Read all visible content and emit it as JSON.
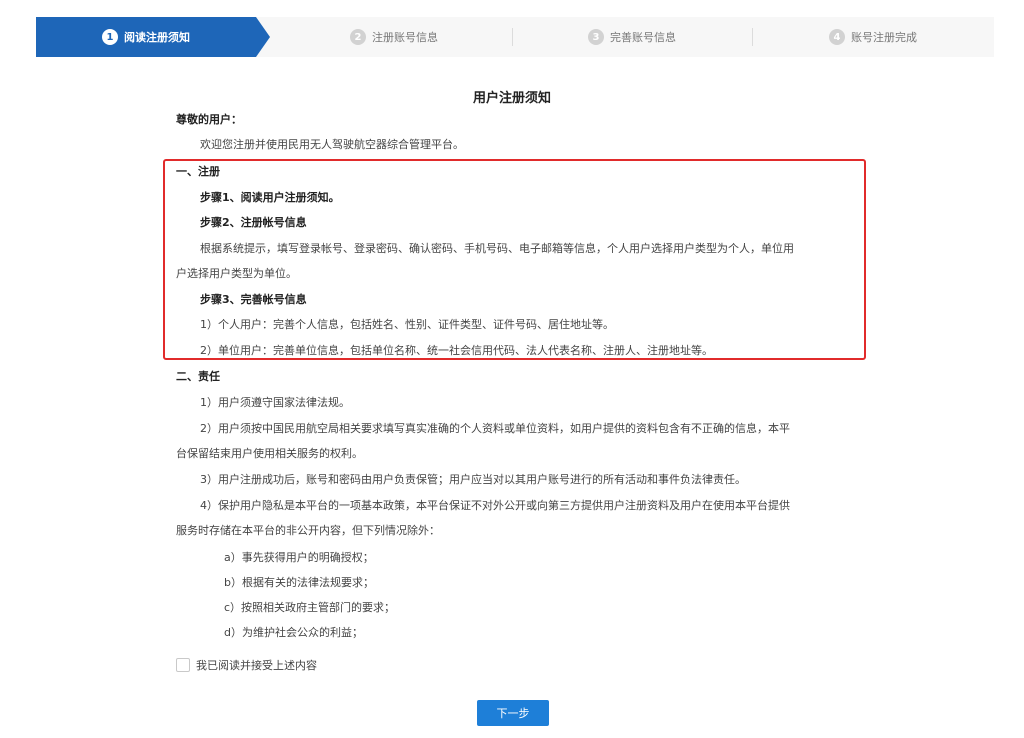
{
  "steps": [
    {
      "num": "1",
      "label": "阅读注册须知",
      "active": true
    },
    {
      "num": "2",
      "label": "注册账号信息",
      "active": false
    },
    {
      "num": "3",
      "label": "完善账号信息",
      "active": false
    },
    {
      "num": "4",
      "label": "账号注册完成",
      "active": false
    }
  ],
  "notice": {
    "title": "用户注册须知",
    "greeting": "尊敬的用户：",
    "welcome": "欢迎您注册并使用民用无人驾驶航空器综合管理平台。",
    "sec1_title": "一、注册",
    "step1": "步骤1、阅读用户注册须知。",
    "step2": "步骤2、注册帐号信息",
    "step2_desc_a": "根据系统提示，填写登录帐号、登录密码、确认密码、手机号码、电子邮箱等信息，个人用户选择用户类型为个人，单位用",
    "step2_desc_b": "户选择用户类型为单位。",
    "step3": "步骤3、完善帐号信息",
    "step3_item1": "1）个人用户：完善个人信息，包括姓名、性别、证件类型、证件号码、居住地址等。",
    "step3_item2": "2）单位用户：完善单位信息，包括单位名称、统一社会信用代码、法人代表名称、注册人、注册地址等。",
    "sec2_title": "二、责任",
    "resp1": "1）用户须遵守国家法律法规。",
    "resp2_a": "2）用户须按中国民用航空局相关要求填写真实准确的个人资料或单位资料，如用户提供的资料包含有不正确的信息，本平",
    "resp2_b": "台保留结束用户使用相关服务的权利。",
    "resp3": "3）用户注册成功后，账号和密码由用户负责保管；用户应当对以其用户账号进行的所有活动和事件负法律责任。",
    "resp4_a": "4）保护用户隐私是本平台的一项基本政策，本平台保证不对外公开或向第三方提供用户注册资料及用户在使用本平台提供",
    "resp4_b": "服务时存储在本平台的非公开内容，但下列情况除外：",
    "exc_a": "a）事先获得用户的明确授权；",
    "exc_b": "b）根据有关的法律法规要求；",
    "exc_c": "c）按照相关政府主管部门的要求；",
    "exc_d": "d）为维护社会公众的利益；"
  },
  "agree_label": "我已阅读并接受上述内容",
  "agree_checked": false,
  "next_label": "下一步",
  "colors": {
    "accent": "#1e66b8",
    "button": "#1e7fd8",
    "highlight": "#e12b2b"
  }
}
